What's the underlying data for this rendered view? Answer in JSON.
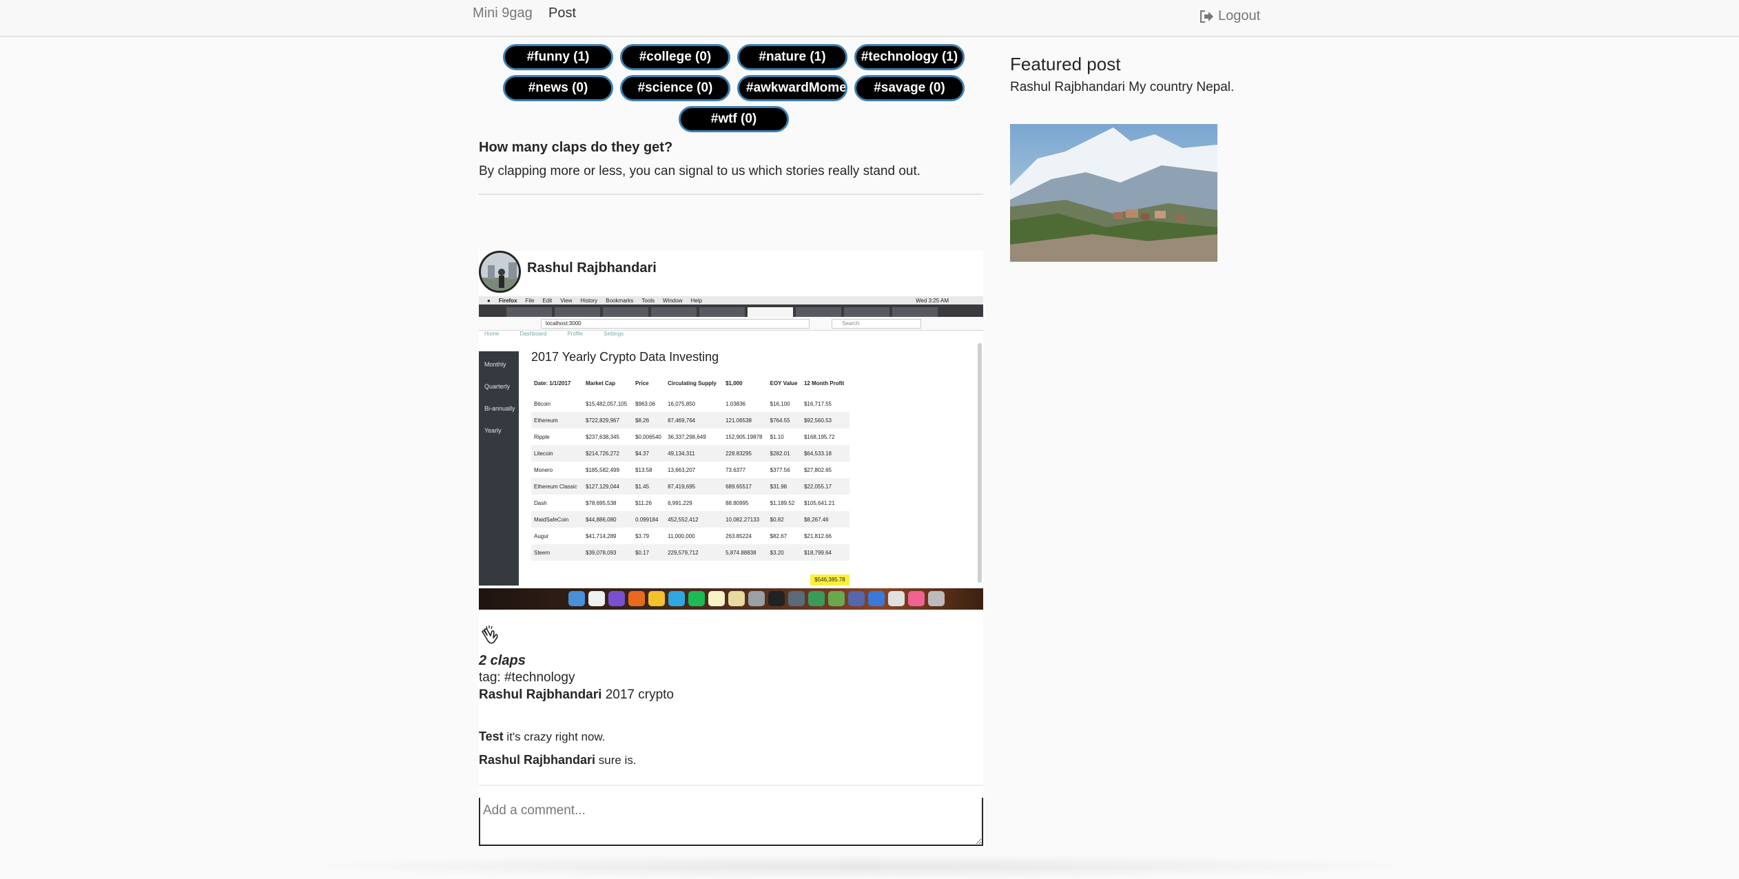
{
  "navbar": {
    "brand": "Mini 9gag",
    "post_link": "Post",
    "logout_label": "Logout"
  },
  "tags": [
    "#funny (1)",
    "#college (0)",
    "#nature (1)",
    "#technology (1)",
    "#news (0)",
    "#science (0)",
    "#awkwardMomen",
    "#savage (0)",
    "#wtf (0)"
  ],
  "intro": {
    "heading": "How many claps do they get?",
    "text": "By clapping more or less, you can signal to us which stories really stand out."
  },
  "post": {
    "author": "Rashul Rajbhandari",
    "claps": "2 claps",
    "tag_line": "tag: #technology",
    "caption_author": "Rashul Rajbhandari",
    "caption_text": "2017 crypto",
    "comments": [
      {
        "author": "Test",
        "text": "it's crazy right now."
      },
      {
        "author": "Rashul Rajbhandari",
        "text": "sure is."
      }
    ],
    "comment_placeholder": "Add a comment...",
    "screenshot": {
      "menu": [
        "Firefox",
        "File",
        "Edit",
        "View",
        "History",
        "Bookmarks",
        "Tools",
        "Window",
        "Help"
      ],
      "clock": "Wed 3:25 AM",
      "url": "localhost:3000",
      "search_placeholder": "Search",
      "app_nav": [
        "Home",
        "Dashboard",
        "Profile",
        "Settings"
      ],
      "sidebar": [
        "Monthly",
        "Quarterly",
        "Bi-annually",
        "Yearly"
      ],
      "title": "2017 Yearly Crypto Data Investing",
      "columns": [
        "Date: 1/1/2017",
        "Market Cap",
        "Price",
        "Circulating Supply",
        "$1,000",
        "EOY Value",
        "12 Month Profit"
      ],
      "rows": [
        [
          "Bitcoin",
          "$15,482,057,105",
          "$963.06",
          "16,075,850",
          "1.03836",
          "$16,100",
          "$16,717.55"
        ],
        [
          "Ethereum",
          "$722,829,967",
          "$8.26",
          "87,469,764",
          "121.06538",
          "$764.55",
          "$92,560.53"
        ],
        [
          "Ripple",
          "$237,638,345",
          "$0.006540",
          "36,337,298,649",
          "152,905.19878",
          "$1.10",
          "$168,195.72"
        ],
        [
          "Litecoin",
          "$214,726,272",
          "$4.37",
          "49,134,311",
          "228.83295",
          "$282.01",
          "$64,533.18"
        ],
        [
          "Monero",
          "$185,582,499",
          "$13.58",
          "13,663,207",
          "73.6377",
          "$377.56",
          "$27,802.65"
        ],
        [
          "Ethereum Classic",
          "$127,129,044",
          "$1.45",
          "87,419,695",
          "689.65517",
          "$31.98",
          "$22,055.17"
        ],
        [
          "Dash",
          "$78,695,538",
          "$11.26",
          "6,991,229",
          "88.80995",
          "$1,189.52",
          "$105,641.21"
        ],
        [
          "MaidSafeCoin",
          "$44,886,080",
          "0.099184",
          "452,552,412",
          "10,082.27133",
          "$0.82",
          "$8,267.46"
        ],
        [
          "Augur",
          "$41,714,289",
          "$3.79",
          "11,000,000",
          "263.85224",
          "$82.67",
          "$21,812.66"
        ],
        [
          "Steem",
          "$39,078,093",
          "$0.17",
          "229,579,712",
          "5,874.88838",
          "$3.20",
          "$18,799.64"
        ]
      ],
      "total": "$546,385.78"
    }
  },
  "featured": {
    "title": "Featured post",
    "author": "Rashul Rajbhandari",
    "text": "My country Nepal."
  }
}
